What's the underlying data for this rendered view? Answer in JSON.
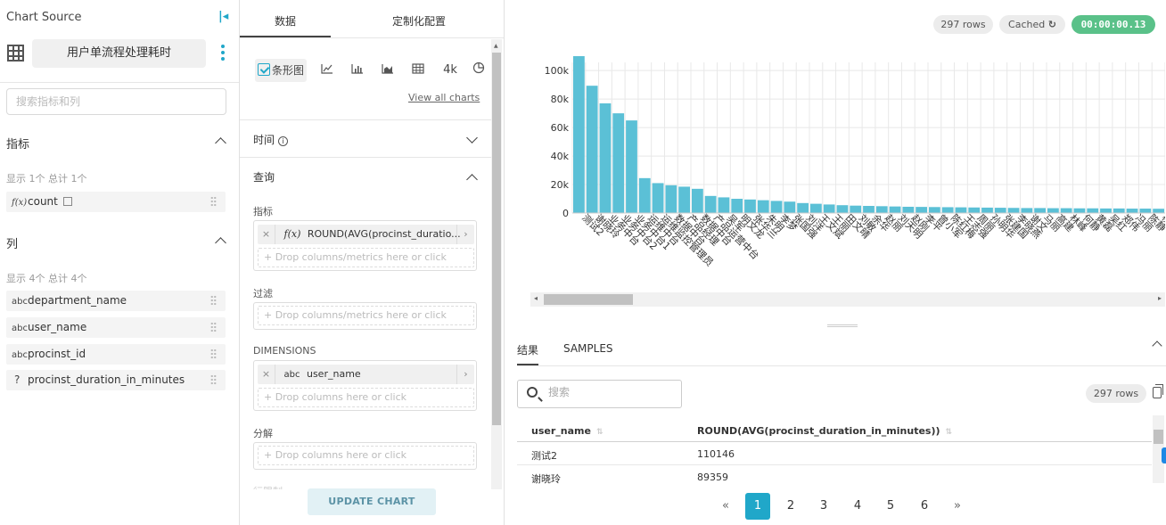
{
  "left": {
    "title": "Chart Source",
    "datasource": "用户单流程处理耗时",
    "search_placeholder": "搜索指标和列",
    "metrics_header": "指标",
    "metrics_count": "显示 1个 总计 1个",
    "metrics": [
      {
        "type": "f(x)",
        "name": "count"
      }
    ],
    "columns_header": "列",
    "columns_count": "显示 4个 总计 4个",
    "columns": [
      {
        "type": "abc",
        "name": "department_name"
      },
      {
        "type": "abc",
        "name": "user_name"
      },
      {
        "type": "abc",
        "name": "procinst_id"
      },
      {
        "type": "?",
        "name": "procinst_duration_in_minutes"
      }
    ]
  },
  "middle": {
    "tabs": [
      "数据",
      "定制化配置"
    ],
    "viz_selected": "条形图",
    "viz_4k": "4k",
    "view_all": "View all charts",
    "time_section": "时间",
    "query_section": "查询",
    "metrics_label": "指标",
    "metric_type": "f(x)",
    "metric_value": "ROUND(AVG(procinst_duratio...",
    "drop_metrics": "+ Drop columns/metrics here or click",
    "filter_label": "过滤",
    "dimensions_label": "DIMENSIONS",
    "dimension_type": "abc",
    "dimension_value": "user_name",
    "drop_columns": "+ Drop columns here or click",
    "breakdown_label": "分解",
    "cut_label": "行限制",
    "update_button": "UPDATE CHART"
  },
  "right": {
    "rows_badge": "297 rows",
    "cached_badge": "Cached",
    "timer": "00:00:00.13",
    "result_tabs": [
      "结果",
      "SAMPLES"
    ],
    "search_placeholder": "搜索",
    "results_rows_badge": "297 rows",
    "table": {
      "headers": [
        "user_name",
        "ROUND(AVG(procinst_duration_in_minutes))"
      ],
      "rows": [
        [
          "测试2",
          "110146"
        ],
        [
          "谢晓玲",
          "89359"
        ]
      ]
    },
    "pagination": {
      "prev": "«",
      "pages": [
        "1",
        "2",
        "3",
        "4",
        "5",
        "6"
      ],
      "next": "»",
      "current": "1"
    }
  },
  "chart_data": {
    "type": "bar",
    "color": "#5bc0d6",
    "yticks": [
      "0",
      "20k",
      "40k",
      "60k",
      "80k",
      "100k"
    ],
    "ylim": [
      0,
      112000
    ],
    "categories": [
      "测试2",
      "谢晓玲",
      "业务中台",
      "业务中台2",
      "业务中台1",
      "运维中台",
      "运维监控管理员",
      "数据中台",
      "产品经理",
      "数据中台",
      "产品运营中台",
      "吴军",
      "明文龙",
      "张华兰",
      "朱明",
      "李梦",
      "张国强",
      "刘洋",
      "王文斌",
      "王丽",
      "田文晴",
      "刘敏",
      "余华",
      "赵丽",
      "刘天明",
      "赵刚",
      "李平",
      "曾小军",
      "陈红梅",
      "王志强",
      "周丽",
      "孙明华",
      "张建国",
      "李晓燕",
      "谢文",
      "马丽",
      "高建",
      "林峰",
      "何静",
      "黄磊",
      "吴红",
      "郑伟",
      "冯丽",
      "陈静",
      "杨洋"
    ],
    "values": [
      110146,
      89359,
      77000,
      70000,
      65000,
      24500,
      21000,
      19500,
      18500,
      17000,
      12000,
      11000,
      10000,
      9500,
      9000,
      8500,
      8000,
      7000,
      6500,
      6000,
      5500,
      5200,
      5000,
      4800,
      4600,
      4400,
      4300,
      4200,
      4100,
      4000,
      3900,
      3800,
      3700,
      3600,
      3500,
      3500,
      3400,
      3400,
      3300,
      3300,
      3200,
      3200,
      3100,
      3100,
      3000
    ]
  }
}
